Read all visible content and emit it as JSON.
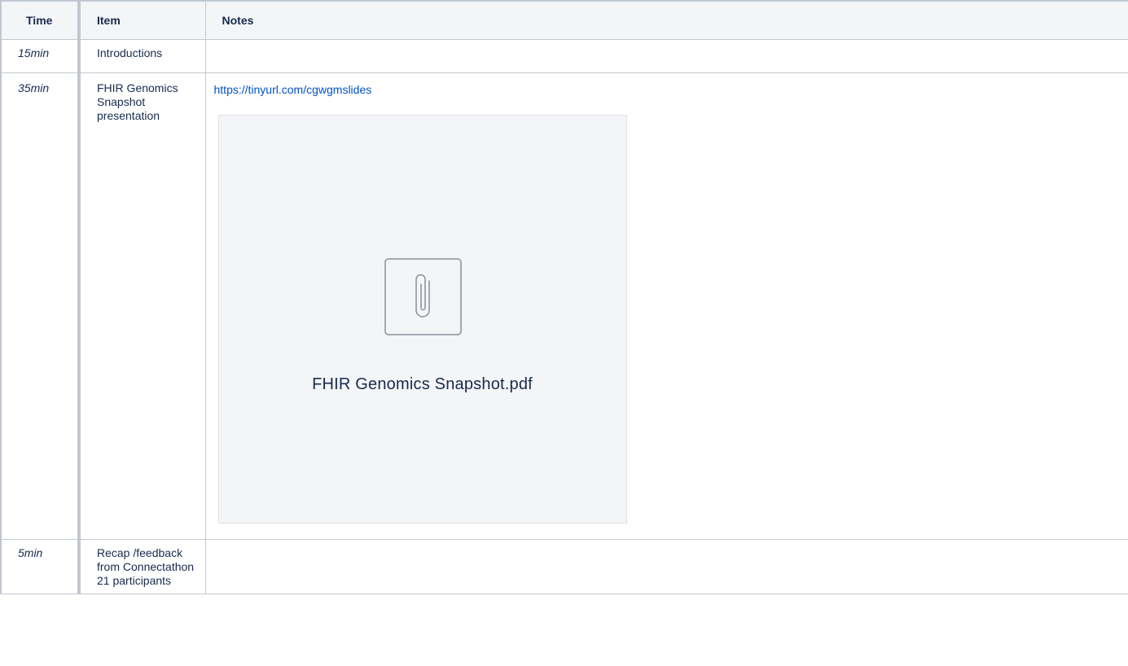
{
  "table": {
    "headers": {
      "time": "Time",
      "item": "Item",
      "notes": "Notes"
    },
    "rows": [
      {
        "time": "15min",
        "item": "Introductions",
        "notes": ""
      },
      {
        "time": "35min",
        "item": "FHIR Genomics Snapshot presentation",
        "notes": {
          "link_text": "https://tinyurl.com/cgwgmslides",
          "attachment": {
            "icon": "paperclip-icon",
            "filename": "FHIR Genomics Snapshot.pdf"
          }
        }
      },
      {
        "time": "5min",
        "item": "Recap /feedback from Connectathon 21 participants",
        "notes": ""
      }
    ]
  },
  "colors": {
    "link": "#0052cc",
    "border": "#c1c7d0",
    "header_bg": "#f4f5f7",
    "attachment_bg": "#f4f5f7"
  }
}
